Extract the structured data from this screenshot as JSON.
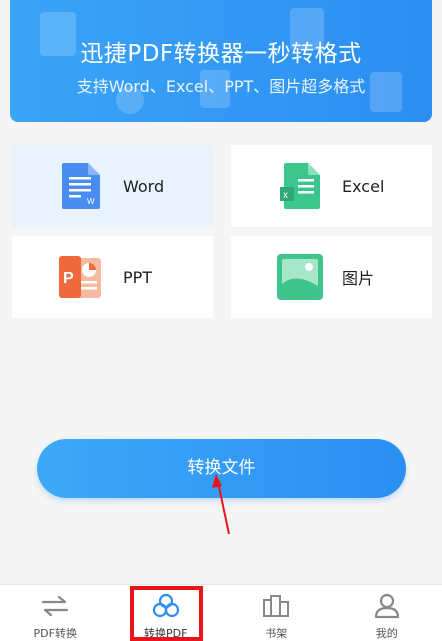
{
  "banner": {
    "title": "迅捷PDF转换器一秒转格式",
    "subtitle": "支持Word、Excel、PPT、图片超多格式"
  },
  "formats": [
    {
      "label": "Word",
      "icon": "word-doc-icon",
      "color": "#4a8df0"
    },
    {
      "label": "Excel",
      "icon": "excel-sheet-icon",
      "color": "#3cc58c"
    },
    {
      "label": "PPT",
      "icon": "ppt-slide-icon",
      "color": "#ee6a3a"
    },
    {
      "label": "图片",
      "icon": "image-picture-icon",
      "color": "#3ec48b"
    }
  ],
  "convert_button": {
    "label": "转换文件"
  },
  "bottom_nav": [
    {
      "label": "PDF转换",
      "icon": "swap-arrows-icon"
    },
    {
      "label": "转换PDF",
      "icon": "cloud-convert-icon"
    },
    {
      "label": "书架",
      "icon": "bookshelf-icon"
    },
    {
      "label": "我的",
      "icon": "user-profile-icon"
    }
  ],
  "colors": {
    "accent": "#2d8ef2",
    "annotation_red": "#e8141b"
  }
}
